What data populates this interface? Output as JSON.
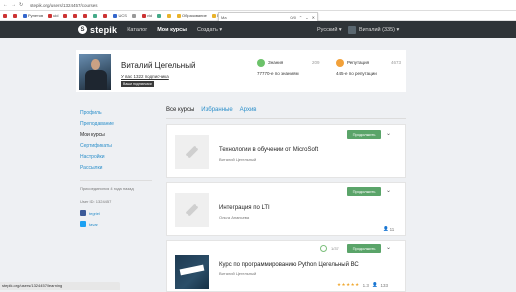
{
  "browser": {
    "url": "stepik.org/users/1324457/courses",
    "bookmarks": [
      {
        "label": "",
        "color": "#c33"
      },
      {
        "label": "",
        "color": "#c33"
      },
      {
        "label": "Рунетов",
        "color": "#36c"
      },
      {
        "label": "uid",
        "color": "#c33"
      },
      {
        "label": "",
        "color": "#c33"
      },
      {
        "label": "",
        "color": "#c33"
      },
      {
        "label": "",
        "color": "#c33"
      },
      {
        "label": "",
        "color": "#4a8"
      },
      {
        "label": "",
        "color": "#c33"
      },
      {
        "label": "UCS",
        "color": "#36c"
      },
      {
        "label": "",
        "color": "#999"
      },
      {
        "label": "vid",
        "color": "#c33"
      },
      {
        "label": "",
        "color": "#4a8"
      },
      {
        "label": "",
        "color": "#e9b32c"
      },
      {
        "label": "Образование",
        "color": "#e9b32c"
      },
      {
        "label": "Путешествия",
        "color": "#e9b32c"
      },
      {
        "label": "ActiveBook",
        "color": "#e9b32c"
      },
      {
        "label": "Другие закладки",
        "color": "#e9b32c"
      }
    ],
    "find": {
      "query": "Ма",
      "count": "0/0"
    },
    "status": "stepik.org/users/1324457/learning"
  },
  "header": {
    "logo": "stepik",
    "nav": [
      "Каталог",
      "Мои курсы",
      "Создать ▾"
    ],
    "language": "Русский ▾",
    "user": "Виталий (335) ▾"
  },
  "profile": {
    "name": "Виталий Цегельный",
    "followers": "У вас 1322 подписчика",
    "tooltip": "Ваши подписчики",
    "knowledge": {
      "label": "Знания",
      "value": "209",
      "sub": "77770-е по знаниям"
    },
    "reputation": {
      "label": "Репутация",
      "value": "4673",
      "sub": "445-е по репутации"
    }
  },
  "sidebar": {
    "items": [
      {
        "label": "Профиль",
        "active": false
      },
      {
        "label": "Преподавание",
        "active": false
      },
      {
        "label": "Мои курсы",
        "active": true
      },
      {
        "label": "Сертификаты",
        "active": false
      },
      {
        "label": "Настройки",
        "active": false
      },
      {
        "label": "Рассылки",
        "active": false
      }
    ],
    "joined": "Присоединился 4 года назад",
    "user_id": "User ID: 1324457",
    "facebook": "tegriel",
    "twitter": "tavar"
  },
  "tabs": [
    "Все курсы",
    "Избранные",
    "Архив"
  ],
  "courses": [
    {
      "title": "Технологии в обучении от MicroSoft",
      "author": "Виталий Цегельный",
      "button": "Продолжить",
      "learners": "",
      "progress": "",
      "rating": "",
      "votes": ""
    },
    {
      "title": "Интеграция по LTI",
      "author": "Ольга Ананьева",
      "button": "Продолжить",
      "learners": "11",
      "progress": "",
      "rating": "",
      "votes": ""
    },
    {
      "title": "Курс по программированию Python Цегельный ВС",
      "author": "Виталий Цегельный",
      "button": "Продолжить",
      "learners": "133",
      "progress": "1/37",
      "rating": "1.3",
      "votes": "★★★★★"
    }
  ]
}
